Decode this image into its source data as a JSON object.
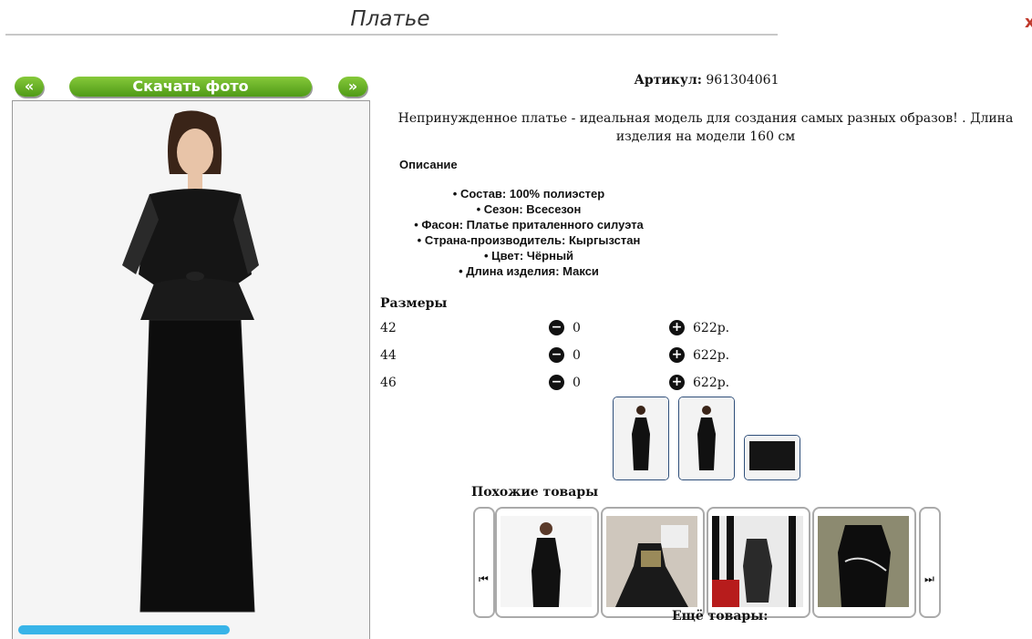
{
  "page": {
    "title": "Платье",
    "close_mark": "х"
  },
  "gallery": {
    "prev_label": "«",
    "download_label": "Скачать фото",
    "next_label": "»"
  },
  "product": {
    "article_label": "Артикул:",
    "article_value": "961304061",
    "description": "Непринужденное платье - идеальная модель для создания самых разных образов! . Длина изделия на модели 160 см",
    "description_heading": "Описание",
    "features": [
      "Состав: 100% полиэстер",
      "Сезон: Всесезон",
      "Фасон: Платье приталенного силуэта",
      "Страна-производитель: Кыргызстан",
      "Цвет: Чёрный",
      "Длина изделия: Макси"
    ]
  },
  "sizes": {
    "heading": "Размеры",
    "rows": [
      {
        "size": "42",
        "qty": "0",
        "price": "622р."
      },
      {
        "size": "44",
        "qty": "0",
        "price": "622р."
      },
      {
        "size": "46",
        "qty": "0",
        "price": "622р."
      }
    ]
  },
  "similar": {
    "heading": "Похожие товары",
    "prev_icon": "skip-back-icon",
    "next_icon": "skip-forward-icon"
  },
  "more": {
    "heading": "Ещё товары:"
  },
  "colors": {
    "accent_green": "#5ea521",
    "border_blue": "#2f4f7a",
    "strip_blue": "#38b4e8",
    "link_green": "#2a8a2a"
  }
}
